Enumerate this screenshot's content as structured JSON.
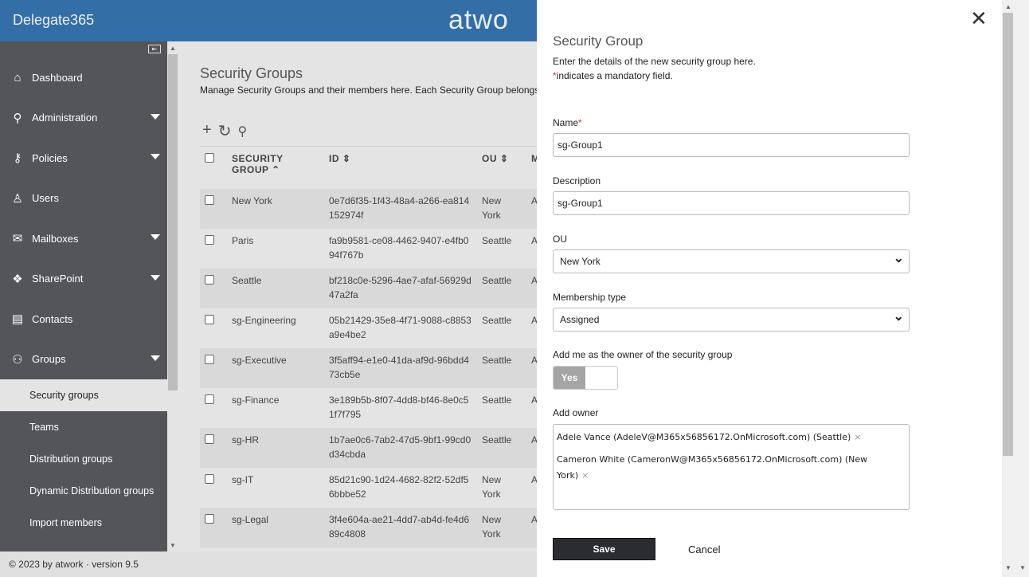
{
  "header": {
    "brand": "Delegate365",
    "logo": "atwo"
  },
  "sidebar": {
    "items": [
      {
        "label": "Dashboard",
        "icon": "home-icon"
      },
      {
        "label": "Administration",
        "icon": "admin-icon"
      },
      {
        "label": "Policies",
        "icon": "key-icon"
      },
      {
        "label": "Users",
        "icon": "user-icon"
      },
      {
        "label": "Mailboxes",
        "icon": "mailbox-icon"
      },
      {
        "label": "SharePoint",
        "icon": "sharepoint-icon"
      },
      {
        "label": "Contacts",
        "icon": "contact-card-icon"
      },
      {
        "label": "Groups",
        "icon": "groups-icon"
      }
    ],
    "subitems": [
      "Security groups",
      "Teams",
      "Distribution groups",
      "Dynamic Distribution groups",
      "Import members"
    ]
  },
  "footer": "© 2023 by atwork · version 9.5",
  "main": {
    "title": "Security Groups",
    "description": "Manage Security Groups and their members here. Each Security Group belongs",
    "columns": [
      "SECURITY GROUP",
      "ID",
      "OU",
      "M T"
    ],
    "rows": [
      {
        "name": "New York",
        "id": "0e7d6f35-1f43-48a4-a266-ea814152974f",
        "ou": "New York",
        "m": "A"
      },
      {
        "name": "Paris",
        "id": "fa9b9581-ce08-4462-9407-e4fb094f767b",
        "ou": "Seattle",
        "m": "A"
      },
      {
        "name": "Seattle",
        "id": "bf218c0e-5296-4ae7-afaf-56929d47a2fa",
        "ou": "Seattle",
        "m": "A"
      },
      {
        "name": "sg-Engineering",
        "id": "05b21429-35e8-4f71-9088-c8853a9e4be2",
        "ou": "Seattle",
        "m": "A"
      },
      {
        "name": "sg-Executive",
        "id": "3f5aff94-e1e0-41da-af9d-96bdd473cb5e",
        "ou": "Seattle",
        "m": "A"
      },
      {
        "name": "sg-Finance",
        "id": "3e189b5b-8f07-4dd8-bf46-8e0c51f7f795",
        "ou": "Seattle",
        "m": "A"
      },
      {
        "name": "sg-HR",
        "id": "1b7ae0c6-7ab2-47d5-9bf1-99cd0d34cbda",
        "ou": "Seattle",
        "m": "A"
      },
      {
        "name": "sg-IT",
        "id": "85d21c90-1d24-4682-82f2-52df56bbbe52",
        "ou": "New York",
        "m": "A"
      },
      {
        "name": "sg-Legal",
        "id": "3f4e604a-ae21-4dd7-ab4d-fe4d689c4808",
        "ou": "New York",
        "m": "A"
      }
    ]
  },
  "panel": {
    "title": "Security Group",
    "intro": "Enter the details of the new security group here.",
    "mandatory_mark": "*",
    "mandatory_note": "indicates a mandatory field.",
    "name_label": "Name",
    "name_value": "sg-Group1",
    "description_label": "Description",
    "description_value": "sg-Group1",
    "ou_label": "OU",
    "ou_value": "New York",
    "membership_label": "Membership type",
    "membership_value": "Assigned",
    "owner_toggle_label": "Add me as the owner of the security group",
    "owner_toggle_value": "Yes",
    "add_owner_label": "Add owner",
    "owners": [
      "Adele Vance (AdeleV@M365x56856172.OnMicrosoft.com) (Seattle)",
      "Cameron White (CameronW@M365x56856172.OnMicrosoft.com) (New York)"
    ],
    "remove_mark": "×",
    "save": "Save",
    "cancel": "Cancel"
  }
}
